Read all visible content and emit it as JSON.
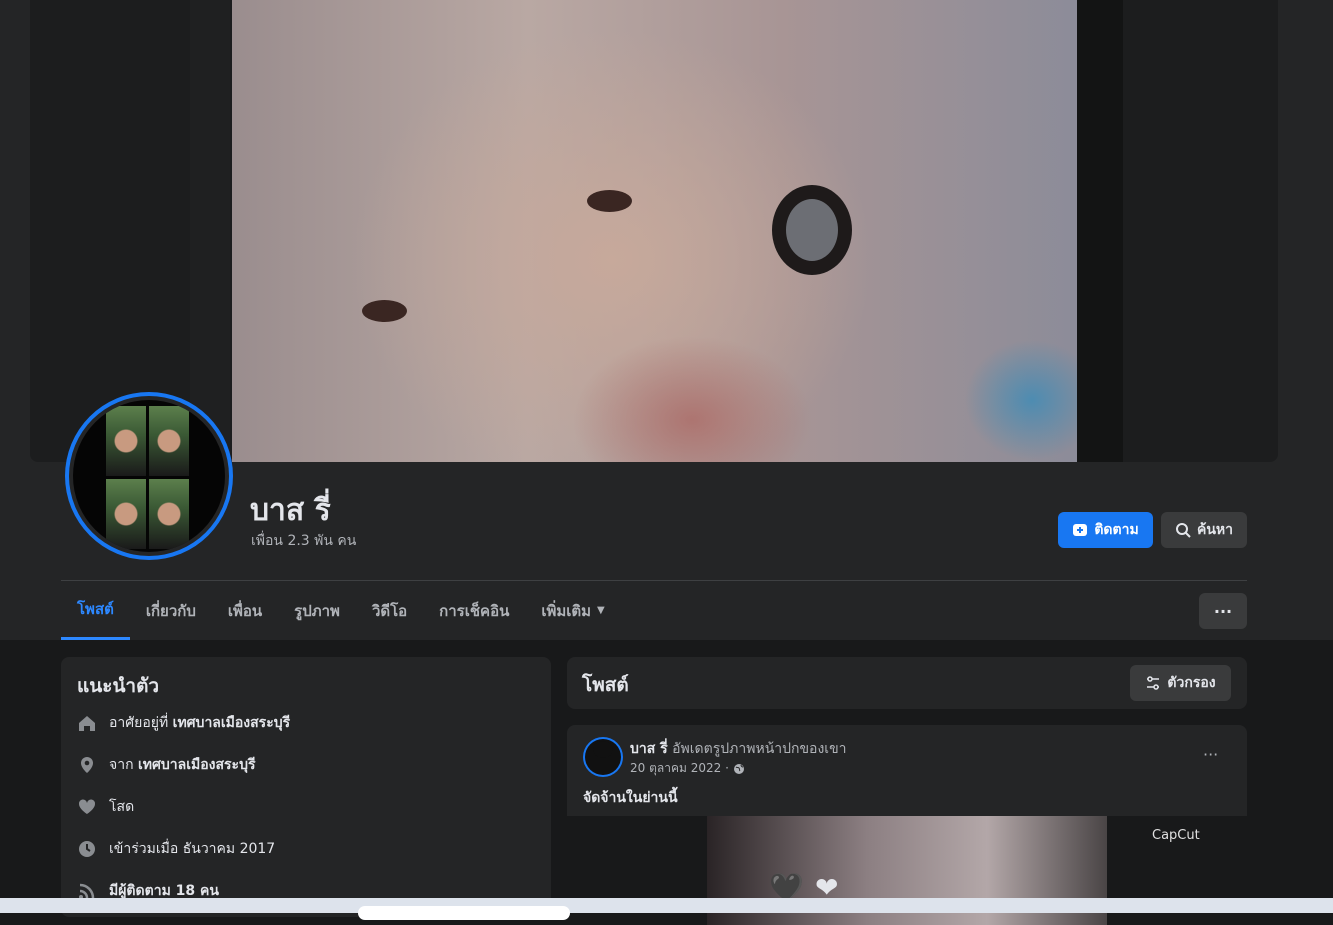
{
  "profile": {
    "name": "บาส รี่",
    "friends": "เพื่อน 2.3 พัน คน"
  },
  "actions": {
    "follow_label": "ติดตาม",
    "search_label": "ค้นหา",
    "more_label": "···"
  },
  "tabs": [
    {
      "label": "โพสต์",
      "active": true
    },
    {
      "label": "เกี่ยวกับ"
    },
    {
      "label": "เพื่อน"
    },
    {
      "label": "รูปภาพ"
    },
    {
      "label": "วิดีโอ"
    },
    {
      "label": "การเช็คอิน"
    },
    {
      "label": "เพิ่มเติม"
    }
  ],
  "intro": {
    "title": "แนะนำตัว",
    "rows": [
      {
        "icon": "home-icon",
        "prefix": "อาศัยอยู่ที่ ",
        "value": "เทศบาลเมืองสระบุรี"
      },
      {
        "icon": "location-pin-icon",
        "prefix": "จาก ",
        "value": "เทศบาลเมืองสระบุรี"
      },
      {
        "icon": "heart-icon",
        "prefix": "โสด",
        "value": ""
      },
      {
        "icon": "clock-icon",
        "prefix": "เข้าร่วมเมื่อ ธันวาคม 2017",
        "value": ""
      },
      {
        "icon": "rss-icon",
        "prefix": "มีผู้ติดตาม 18 คน",
        "value": ""
      }
    ]
  },
  "posts": {
    "title": "โพสต์",
    "filter_label": "ตัวกรอง",
    "items": [
      {
        "author": "บาส รี่",
        "action": " อัพเดตรูปภาพหน้าปกของเขา",
        "date": "20 ตุลาคม 2022 ·",
        "text": "จัดจ้านในย่านนี้",
        "watermark": "CapCut"
      }
    ]
  },
  "colors": {
    "accent": "#1877f2",
    "background": "#18191a",
    "card": "#242526"
  }
}
